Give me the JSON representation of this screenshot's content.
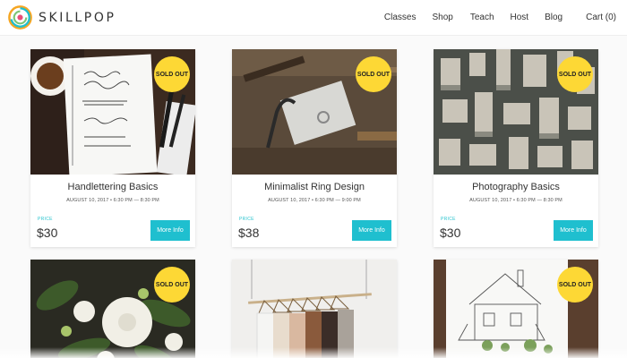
{
  "brand": {
    "name": "SKILLPOP"
  },
  "nav": {
    "items": [
      {
        "label": "Classes"
      },
      {
        "label": "Shop"
      },
      {
        "label": "Teach"
      },
      {
        "label": "Host"
      },
      {
        "label": "Blog"
      },
      {
        "label": "Cart (0)"
      }
    ]
  },
  "colors": {
    "accent": "#1fbfcf",
    "badge": "#fdd835"
  },
  "cards": [
    {
      "badge": "SOLD OUT",
      "title": "Handlettering Basics",
      "date": "AUGUST 10, 2017 • 6:30 PM — 8:30 PM",
      "price_label": "PRICE",
      "price": "$30",
      "button": "More Info",
      "image": "handlettering-notebook-photo"
    },
    {
      "badge": "SOLD OUT",
      "title": "Minimalist Ring Design",
      "date": "AUGUST 10, 2017 • 6:30 PM — 9:00 PM",
      "price_label": "PRICE",
      "price": "$38",
      "button": "More Info",
      "image": "jewelry-tools-photo"
    },
    {
      "badge": "SOLD OUT",
      "title": "Photography Basics",
      "date": "AUGUST 10, 2017 • 6:30 PM — 8:30 PM",
      "price_label": "PRICE",
      "price": "$30",
      "button": "More Info",
      "image": "city-aerial-photo"
    },
    {
      "badge": "SOLD OUT",
      "image": "white-flowers-photo"
    },
    {
      "image": "clothing-rack-photo"
    },
    {
      "badge": "SOLD OUT",
      "image": "house-sketch-photo"
    }
  ]
}
